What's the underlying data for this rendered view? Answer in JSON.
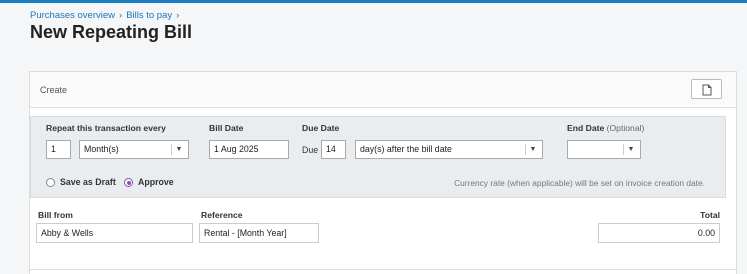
{
  "breadcrumb": {
    "items": [
      "Purchases overview",
      "Bills to pay"
    ],
    "separator": "›"
  },
  "page_title": "New Repeating Bill",
  "card": {
    "header_label": "Create",
    "copy_icon": "document-icon"
  },
  "schedule": {
    "repeat_label": "Repeat this transaction every",
    "repeat_count": "1",
    "repeat_unit": "Month(s)",
    "bill_date_label": "Bill Date",
    "bill_date": "1 Aug 2025",
    "due_date_label": "Due Date",
    "due_prefix": "Due",
    "due_value": "14",
    "due_terms": "day(s) after the bill date",
    "end_date_label": "End Date",
    "end_date_optional": "(Optional)",
    "end_date": ""
  },
  "status_options": {
    "draft_label": "Save as Draft",
    "approve_label": "Approve",
    "selected": "Approve"
  },
  "currency_note": "Currency rate (when applicable) will be set on invoice creation date.",
  "bill": {
    "from_label": "Bill from",
    "from_value": "Abby & Wells",
    "reference_label": "Reference",
    "reference_value": "Rental - [Month Year]",
    "total_label": "Total",
    "total_value": "0.00"
  },
  "colors": {
    "topbar": "#1a7fc1",
    "link": "#1b75bb",
    "radio_selected": "#8a4fb0"
  }
}
